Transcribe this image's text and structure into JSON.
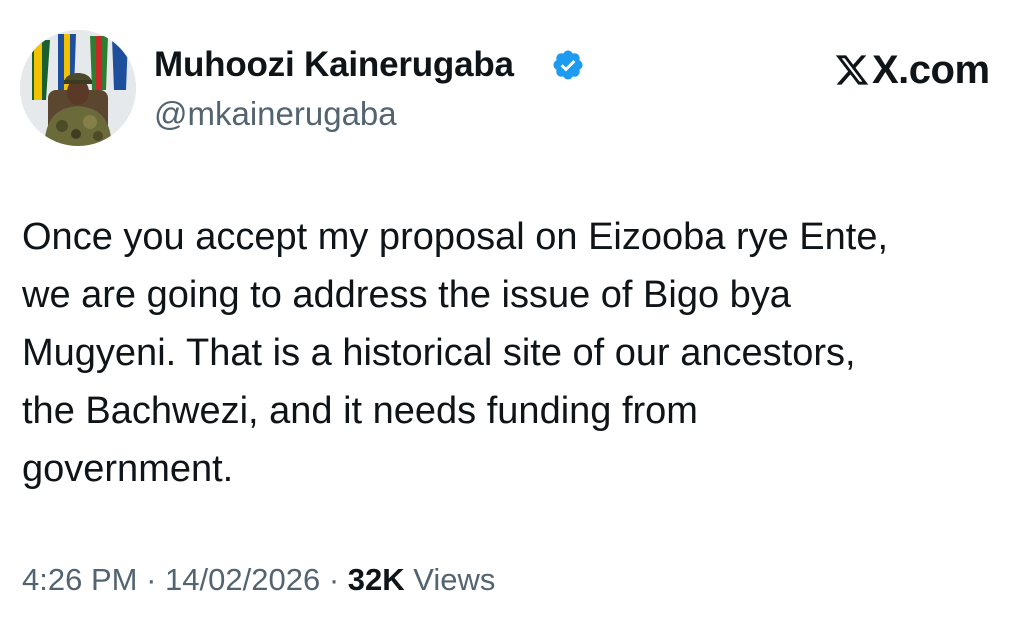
{
  "author": {
    "name": "Muhoozi Kainerugaba",
    "handle": "@mkainerugaba",
    "verified": true
  },
  "brand": {
    "domain": "X.com"
  },
  "tweet": {
    "lines": [
      "Once you accept my proposal on Eizooba rye Ente,",
      "we are going to address the issue of Bigo bya",
      "Mugyeni. That is a historical site of our ancestors,",
      "the Bachwezi, and it needs funding from",
      "government."
    ]
  },
  "meta": {
    "time": "4:26 PM",
    "separator": "·",
    "date": "14/02/2026",
    "views_count": "32K",
    "views_label": "Views"
  },
  "colors": {
    "text_primary": "#0f1419",
    "text_secondary": "#536471",
    "verified_blue": "#1d9bf0"
  },
  "icons": {
    "verified": "verified-badge-icon",
    "brand": "x-logo-icon"
  }
}
